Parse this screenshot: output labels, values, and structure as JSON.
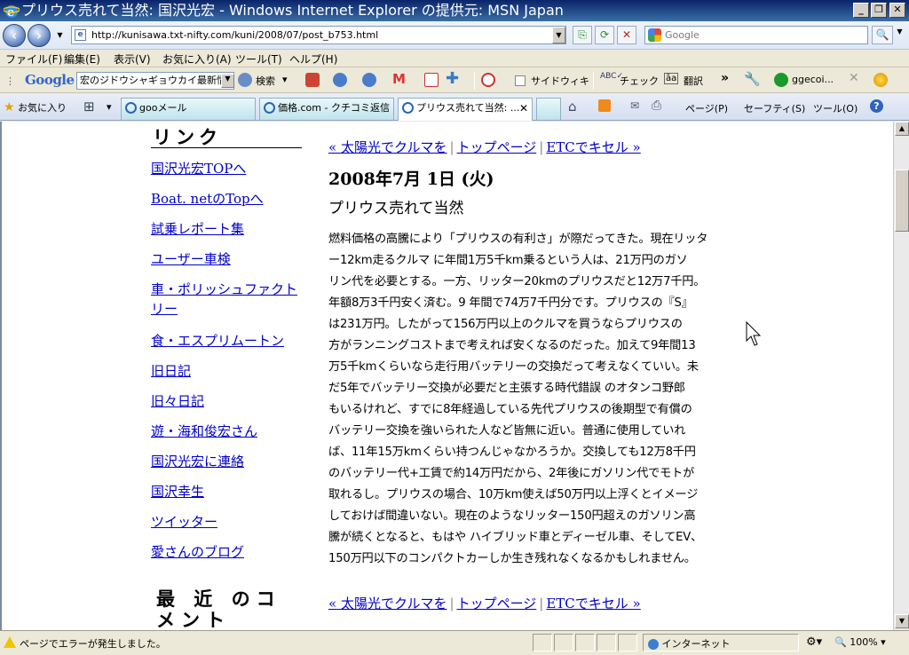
{
  "window": {
    "title": "プリウス売れて当然: 国沢光宏 - Windows Internet Explorer の提供元: MSN Japan",
    "minimize": "_",
    "restore": "❐",
    "close": "✕"
  },
  "address": {
    "url": "http://kunisawa.txt-nifty.com/kuni/2008/07/post_b753.html",
    "search_placeholder": "Google"
  },
  "menu": [
    "ファイル(F)",
    "編集(E)",
    "表示(V)",
    "お気に入り(A)",
    "ツール(T)",
    "ヘルプ(H)"
  ],
  "google_toolbar": {
    "logo": "Google",
    "query": "宏のジドウシャギョウカイ最新情報",
    "search": "検索",
    "sidewiki": "サイドウィキ",
    "check": "チェック",
    "translate": "翻訳",
    "account": "ggecoi..."
  },
  "tabs_row": {
    "favorites": "お気に入り",
    "tabs": [
      {
        "label": "gooメール"
      },
      {
        "label": "価格.com - クチコミ返信"
      },
      {
        "label": "プリウス売れて当然: ..."
      }
    ],
    "commands": {
      "page": "ページ(P)",
      "safety": "セーフティ(S)",
      "tools": "ツール(O)"
    }
  },
  "sidebar": {
    "title": "リンク",
    "links": [
      "国沢光宏TOPへ",
      "Boat. netのTopへ",
      "試乗レポート集",
      "ユーザー車検",
      "車・ポリッシュファクトリー",
      "食・エスプリムートン",
      "旧日記",
      "旧々日記",
      "遊・海和俊宏さん",
      "国沢光宏に連絡",
      "国沢幸生",
      "ツイッター",
      "愛さんのブログ"
    ],
    "recent_comments_title": "最 近 のコメント"
  },
  "post": {
    "nav": {
      "prev": "« 太陽光でクルマを",
      "top": "トップページ",
      "next": "ETCでキセル »"
    },
    "date": "2008年7月 1日 (火)",
    "title": "プリウス売れて当然",
    "lines": [
      "燃料価格の高騰により「プリウスの有利さ」が際だってきた。現在リッタ",
      "ー12km走るクルマ に年間1万5千km乗るという人は、21万円のガソ",
      "リン代を必要とする。一方、リッター20kmのプリウスだと12万7千円。",
      "年額8万3千円安く済む。9 年間で74万7千円分です。プリウスの『S』",
      "は231万円。したがって156万円以上のクルマを買うならプリウスの",
      "方がランニングコストまで考えれば安くなるのだった。加えて9年間13",
      "万5千kmくらいなら走行用バッテリーの交換だって考えなくていい。未",
      "だ5年でバッテリー交換が必要だと主張する時代錯誤 のオタンコ野郎",
      "もいるけれど、すでに8年経過している先代プリウスの後期型で有償の",
      "バッテリー交換を強いられた人など皆無に近い。普通に使用していれ",
      "ば、11年15万kmくらい持つんじゃなかろうか。交換しても12万8千円",
      "のバッテリー代+工賃で約14万円だから、2年後にガソリン代でモトが",
      "取れるし。プリウスの場合、10万km使えば50万円以上浮くとイメージ",
      "しておけば間違いない。現在のようなリッター150円超えのガソリン高",
      "騰が続くとなると、もはや ハイブリッド車とディーゼル車、そしてEV、",
      "150万円以下のコンパクトカーしか生き残れなくなるかもしれません。"
    ]
  },
  "status": {
    "message": "ページでエラーが発生しました。",
    "zone": "インターネット",
    "zoom": "100%"
  }
}
